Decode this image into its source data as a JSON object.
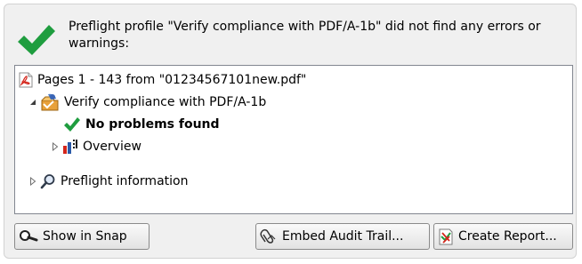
{
  "status": {
    "icon": "checkmark-icon",
    "message": "Preflight profile \"Verify compliance with PDF/A-1b\" did not find any errors or warnings:",
    "accent_color": "#1f9d3f"
  },
  "tree": {
    "root": {
      "icon": "pdf-file-icon",
      "label": "Pages 1 - 143 from \"01234567101new.pdf\""
    },
    "profile": {
      "expander": "expanded",
      "icon": "preflight-profile-icon",
      "label": "Verify compliance with PDF/A-1b"
    },
    "result": {
      "icon": "checkmark-icon",
      "label": "No problems found"
    },
    "overview": {
      "expander": "collapsed",
      "icon": "overview-chart-icon",
      "label": "Overview"
    },
    "info": {
      "expander": "collapsed",
      "icon": "magnifier-icon",
      "label": "Preflight information"
    }
  },
  "buttons": {
    "show_in_snap": {
      "label": "Show in Snap",
      "icon": "snap-magnifier-icon"
    },
    "embed_audit_trail": {
      "label": "Embed Audit Trail...",
      "icon": "paperclip-icon"
    },
    "create_report": {
      "label": "Create Report...",
      "icon": "report-icon"
    }
  }
}
